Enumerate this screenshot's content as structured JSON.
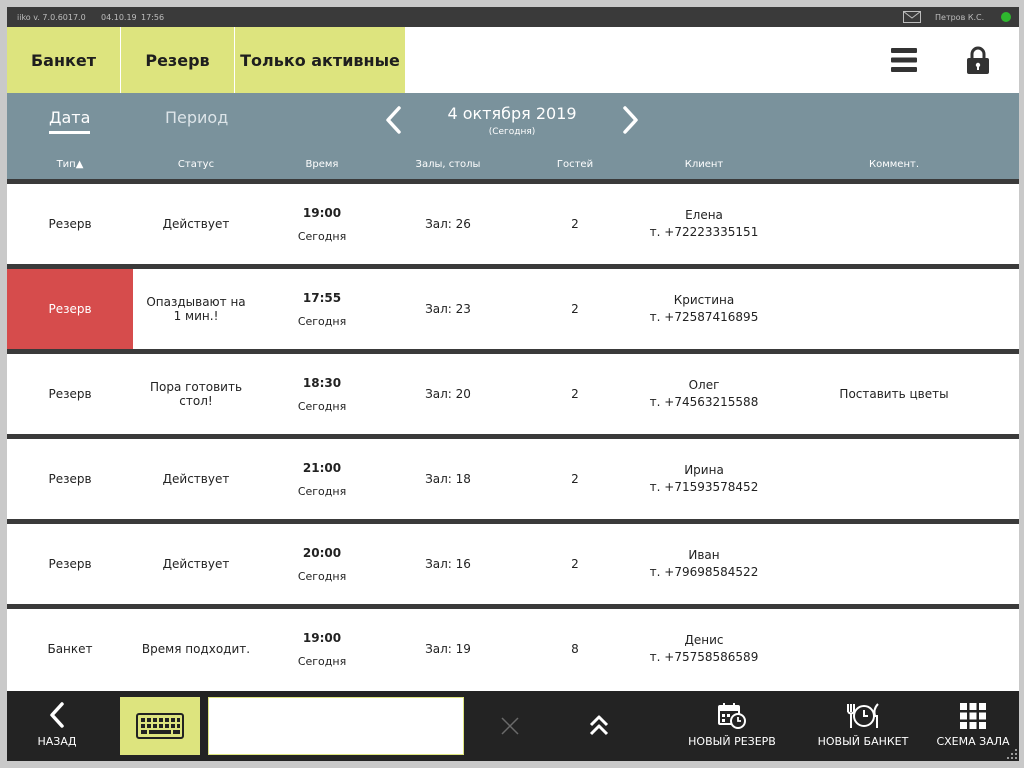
{
  "status_bar": {
    "version": "iiko  v. 7.0.6017.0",
    "date": "04.10.19",
    "time": "17:56",
    "user": "Петров К.С.",
    "online_color": "#2eb82e"
  },
  "top_bar": {
    "banquet_label": "Банкет",
    "reserve_label": "Резерв",
    "active_only_label": "Только активные",
    "menu_icon": "hamburger-menu-icon",
    "lock_icon": "lock-icon",
    "accent_color": "#dde47e"
  },
  "date_nav": {
    "tab_date": "Дата",
    "tab_period": "Период",
    "current_date": "4 октября 2019",
    "current_sub": "(Сегодня)"
  },
  "table": {
    "headers": {
      "type": "Тип▲",
      "status": "Статус",
      "time": "Время",
      "halls": "Залы, столы",
      "guests": "Гостей",
      "client": "Клиент",
      "comment": "Коммент."
    },
    "rows": [
      {
        "type": "Резерв",
        "status": "Действует",
        "time": "19:00",
        "day": "Сегодня",
        "hall": "Зал: 26",
        "guests": "2",
        "client_name": "Елена",
        "client_phone": "т. +72223335151",
        "comment": ""
      },
      {
        "type": "Резерв",
        "status": "Опаздывают на 1 мин.!",
        "time": "17:55",
        "day": "Сегодня",
        "hall": "Зал: 23",
        "guests": "2",
        "client_name": "Кристина",
        "client_phone": "т. +72587416895",
        "comment": ""
      },
      {
        "type": "Резерв",
        "status": "Пора готовить стол!",
        "time": "18:30",
        "day": "Сегодня",
        "hall": "Зал: 20",
        "guests": "2",
        "client_name": "Олег",
        "client_phone": "т. +74563215588",
        "comment": "Поставить цветы"
      },
      {
        "type": "Резерв",
        "status": "Действует",
        "time": "21:00",
        "day": "Сегодня",
        "hall": "Зал: 18",
        "guests": "2",
        "client_name": "Ирина",
        "client_phone": "т. +71593578452",
        "comment": ""
      },
      {
        "type": "Резерв",
        "status": "Действует",
        "time": "20:00",
        "day": "Сегодня",
        "hall": "Зал: 16",
        "guests": "2",
        "client_name": "Иван",
        "client_phone": "т. +79698584522",
        "comment": ""
      },
      {
        "type": "Банкет",
        "status": "Время подходит.",
        "time": "19:00",
        "day": "Сегодня",
        "hall": "Зал: 19",
        "guests": "8",
        "client_name": "Денис",
        "client_phone": "т. +75758586589",
        "comment": ""
      }
    ],
    "alert_color": "#d64c4c"
  },
  "bottom_bar": {
    "back_label": "НАЗАД",
    "search_value": "",
    "new_reserve_label": "НОВЫЙ РЕЗЕРВ",
    "new_banquet_label": "НОВЫЙ БАНКЕТ",
    "hall_scheme_label": "СХЕМА ЗАЛА"
  }
}
